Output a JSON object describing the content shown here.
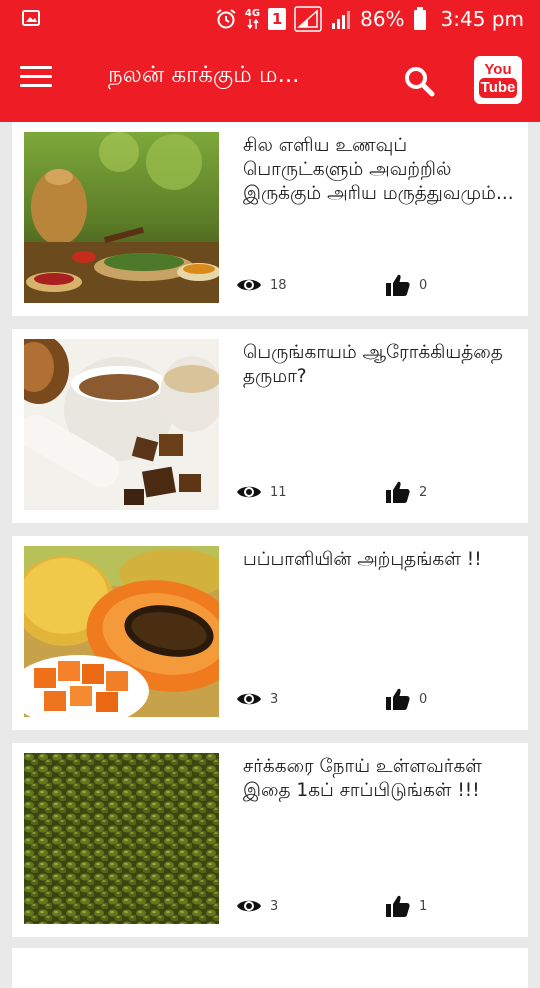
{
  "status_bar": {
    "network_label": "4G",
    "sim_label": "1",
    "battery": "86%",
    "time": "3:45 pm"
  },
  "app_bar": {
    "title": "நலன் காக்கும் ம...",
    "icons": [
      "menu-icon",
      "search-icon",
      "youtube-icon"
    ],
    "youtube_top": "You",
    "youtube_bottom": "Tube"
  },
  "colors": {
    "primary": "#ee1c24",
    "card": "#ffffff",
    "background": "#e9e9e9"
  },
  "articles": [
    {
      "title": "சில எளிய உணவுப் பொருட்களும் அவற்றில் இருக்கும் அரிய மருத்துவமும்...",
      "views": "18",
      "likes": "0"
    },
    {
      "title": "பெருங்காயம் ஆரோக்கியத்தை தருமா?",
      "views": "11",
      "likes": "2"
    },
    {
      "title": "பப்பாளியின் அற்புதங்கள் !!",
      "views": "3",
      "likes": "0"
    },
    {
      "title": " சர்க்கரை நோய் உள்ளவர்கள் இதை 1கப் சாப்பிடுங்கள் !!!",
      "views": "3",
      "likes": "1"
    }
  ]
}
